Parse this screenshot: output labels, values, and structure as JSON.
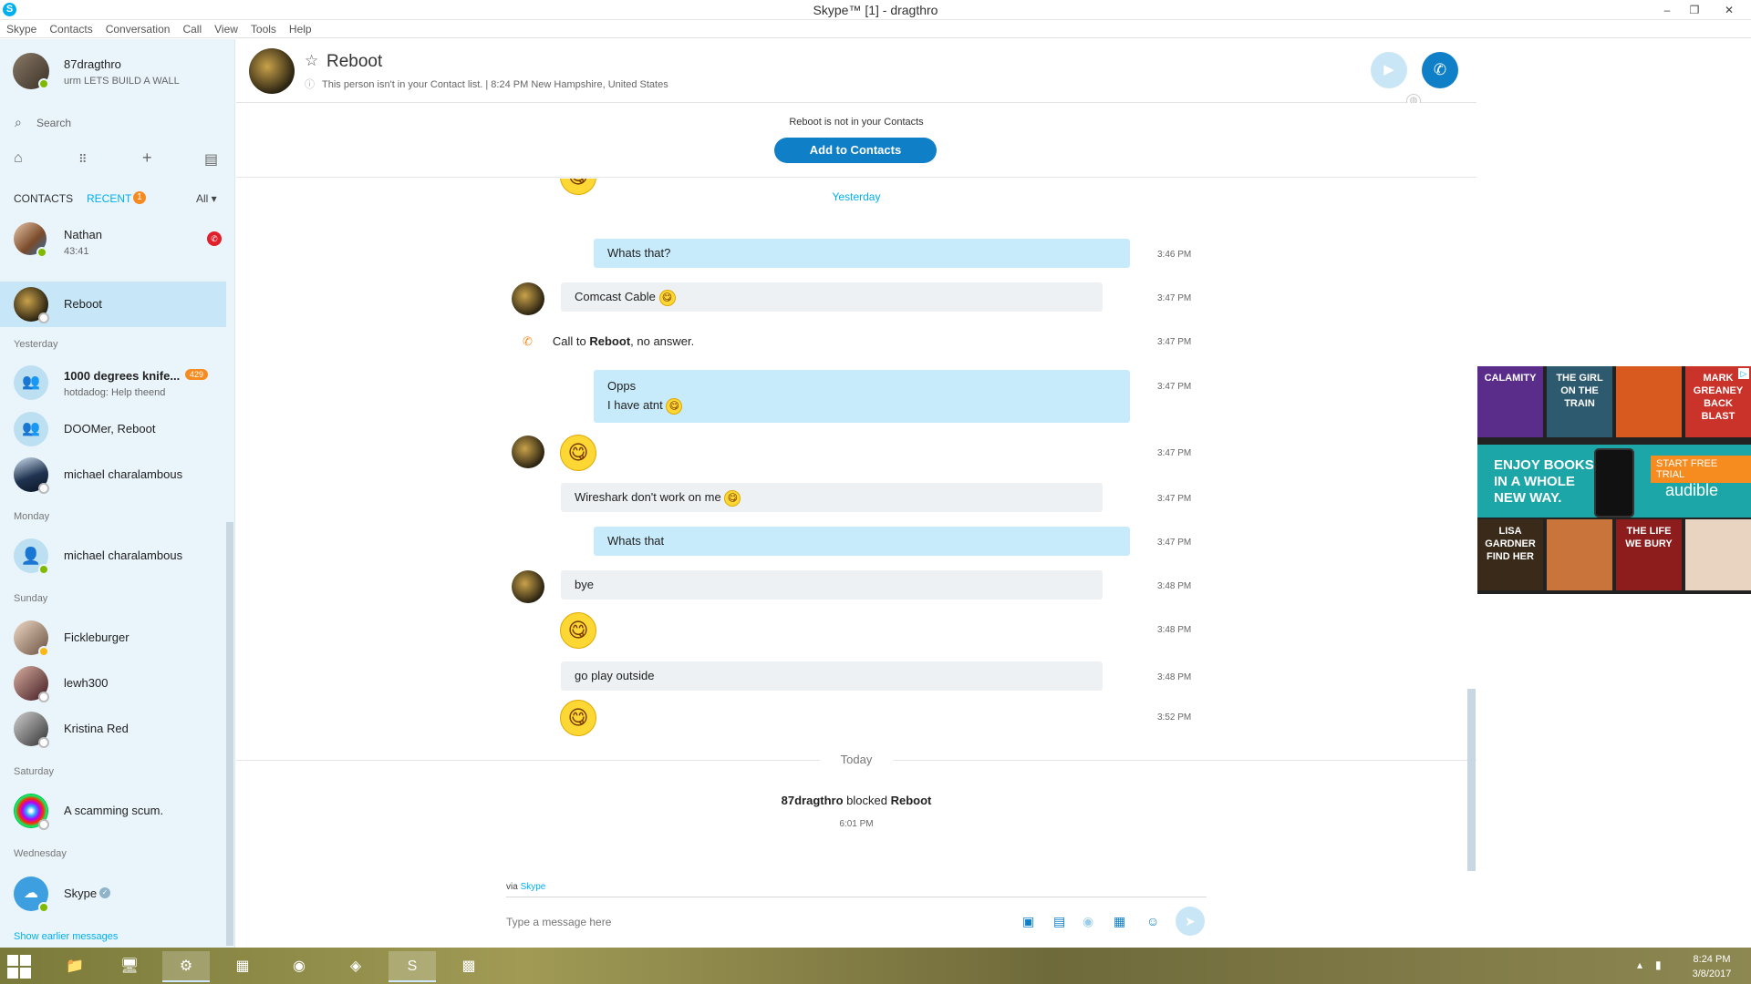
{
  "window": {
    "title": "Skype™ [1] - dragthro",
    "minimize": "–",
    "restore": "❐",
    "close": "✕"
  },
  "menu": [
    "Skype",
    "Contacts",
    "Conversation",
    "Call",
    "View",
    "Tools",
    "Help"
  ],
  "profile": {
    "name": "87dragthro",
    "mood": "urm LETS BUILD A WALL"
  },
  "search": {
    "placeholder": "Search"
  },
  "tabs": {
    "contacts": "CONTACTS",
    "recent": "RECENT",
    "recent_badge": "1",
    "filter": "All ▾"
  },
  "sidebar": {
    "groups": {
      "yesterday": "Yesterday",
      "monday": "Monday",
      "sunday": "Sunday",
      "saturday": "Saturday",
      "wednesday": "Wednesday"
    },
    "contacts": [
      {
        "name": "Nathan",
        "sub": "43:41"
      },
      {
        "name": "Reboot"
      },
      {
        "name": "1000 degrees knife...",
        "sub": "hotdadog: Help theend",
        "badge": "429"
      },
      {
        "name": "DOOMer, Reboot"
      },
      {
        "name": "michael charalambous"
      },
      {
        "name": "michael charalambous"
      },
      {
        "name": "Fickleburger"
      },
      {
        "name": "lewh300"
      },
      {
        "name": "Kristina Red"
      },
      {
        "name": "A scamming scum."
      },
      {
        "name": "Skype"
      }
    ],
    "show_earlier": "Show earlier messages"
  },
  "conversation": {
    "name": "Reboot",
    "info": "This person isn't in your Contact list.  |  8:24 PM New Hampshire, United States",
    "not_in_contacts": "Reboot is not in your Contacts",
    "add_button": "Add to Contacts",
    "yesterday_label": "Yesterday",
    "today_label": "Today",
    "messages": [
      {
        "text": "Whats that?",
        "time": "3:46 PM"
      },
      {
        "text": "Comcast Cable",
        "time": "3:47 PM"
      },
      {
        "call_prefix": "Call to ",
        "call_name": "Reboot",
        "call_suffix": ", no answer.",
        "time": "3:47 PM"
      },
      {
        "text": "Opps",
        "text2": "I have atnt",
        "time": "3:47 PM"
      },
      {
        "time": "3:47 PM"
      },
      {
        "text": "Wireshark don't work on me",
        "time": "3:47 PM"
      },
      {
        "text": "Whats that",
        "time": "3:47 PM"
      },
      {
        "text": "bye",
        "time": "3:48 PM"
      },
      {
        "time": "3:48 PM"
      },
      {
        "text": "go play outside",
        "time": "3:48 PM"
      },
      {
        "time": "3:52 PM"
      }
    ],
    "blocked": {
      "actor": "87dragthro",
      "verb": " blocked ",
      "target": "Reboot",
      "time": "6:01 PM"
    },
    "via_prefix": "via ",
    "via_link": "Skype",
    "compose_placeholder": "Type a message here"
  },
  "ad": {
    "books": [
      "CALAMITY",
      "THE GIRL ON THE TRAIN",
      "",
      "MARK GREANEY BACK BLAST",
      "LISA GARDNER FIND HER",
      "",
      "THE LIFE WE BURY",
      ""
    ],
    "headline": "ENJOY BOOKS IN A WHOLE NEW WAY.",
    "cta": "START FREE TRIAL",
    "brand": "audible"
  },
  "taskbar": {
    "time": "8:24 PM",
    "date": "3/8/2017"
  }
}
